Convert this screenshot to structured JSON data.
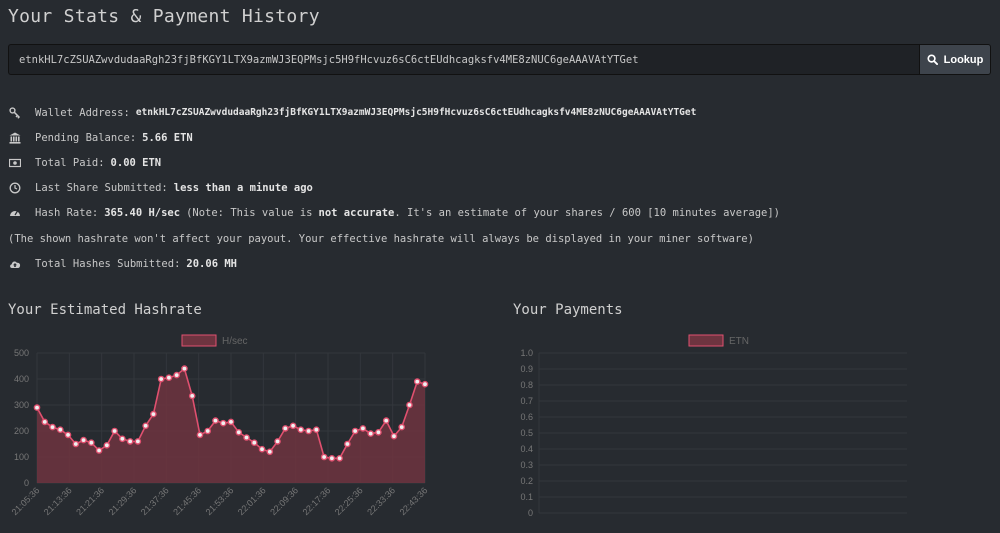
{
  "page": {
    "title": "Your Stats & Payment History"
  },
  "lookup": {
    "address_value": "etnkHL7cZSUAZwvdudaaRgh23fjBfKGY1LTX9azmWJ3EQPMsjc5H9fHcvuz6sC6ctEUdhcagksfv4ME8zNUC6geAAAVAtYTGet",
    "button_label": "Lookup",
    "button_icon": "search-icon"
  },
  "stats": {
    "wallet_label": "Wallet Address:",
    "wallet_value": "etnkHL7cZSUAZwvdudaaRgh23fjBfKGY1LTX9azmWJ3EQPMsjc5H9fHcvuz6sC6ctEUdhcagksfv4ME8zNUC6geAAAVAtYTGet",
    "pending_label": "Pending Balance:",
    "pending_value": "5.66 ETN",
    "paid_label": "Total Paid:",
    "paid_value": "0.00 ETN",
    "last_share_label": "Last Share Submitted:",
    "last_share_value": "less than a minute ago",
    "hashrate_label": "Hash Rate:",
    "hashrate_value": "365.40 H/sec",
    "hashrate_note_prefix": "(Note: This value is",
    "hashrate_note_bold": "not accurate",
    "hashrate_note_suffix": ". It's an estimate of your shares / 600 [10 minutes average])",
    "hashrate_disclaimer": "(The shown hashrate won't affect your payout. Your effective hashrate will always be displayed in your miner software)",
    "total_hashes_label": "Total Hashes Submitted:",
    "total_hashes_value": "20.06 MH"
  },
  "hashrate_section": {
    "title": "Your Estimated Hashrate"
  },
  "payments_section": {
    "title": "Your Payments"
  },
  "colors": {
    "background": "#272b30",
    "series_line": "#e0506f",
    "series_fill": "#6e3440",
    "grid": "#33373c"
  },
  "chart_data": [
    {
      "type": "area",
      "title": "",
      "legend": "top",
      "grid": true,
      "series": [
        {
          "name": "H/sec",
          "values": [
            290,
            235,
            215,
            205,
            185,
            150,
            165,
            155,
            125,
            145,
            200,
            170,
            160,
            160,
            220,
            265,
            400,
            405,
            415,
            440,
            335,
            185,
            200,
            240,
            230,
            235,
            195,
            175,
            155,
            130,
            120,
            160,
            210,
            220,
            205,
            200,
            205,
            100,
            95,
            95,
            150,
            200,
            210,
            190,
            195,
            240,
            180,
            215,
            300,
            390,
            380
          ]
        }
      ],
      "x_tick_labels": [
        "21:05:36",
        "21:13:36",
        "21:21:36",
        "21:29:36",
        "21:37:36",
        "21:45:36",
        "21:53:36",
        "22:01:36",
        "22:09:36",
        "22:17:36",
        "22:25:36",
        "22:33:36",
        "22:43:36"
      ],
      "xlabel": "",
      "ylabel": "",
      "ylim": [
        0,
        500
      ],
      "y_ticks": [
        0,
        100,
        200,
        300,
        400,
        500
      ]
    },
    {
      "type": "line",
      "title": "",
      "legend": "top",
      "grid": true,
      "series": [
        {
          "name": "ETN",
          "values": []
        }
      ],
      "xlabel": "",
      "ylabel": "",
      "ylim": [
        0,
        1.0
      ],
      "y_ticks": [
        0,
        0.1,
        0.2,
        0.3,
        0.4,
        0.5,
        0.6,
        0.7,
        0.8,
        0.9,
        1.0
      ]
    }
  ]
}
